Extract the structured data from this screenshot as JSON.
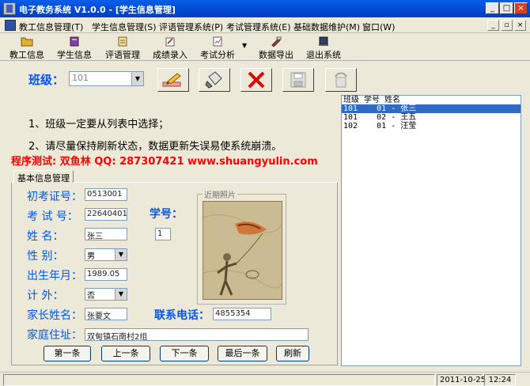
{
  "window": {
    "title": "电子教务系统 V1.0.0 - [学生信息管理]",
    "buttons": {
      "minimize": "_",
      "maximize": "□",
      "close": "×"
    }
  },
  "menubar": {
    "items": [
      {
        "label": "教工信息管理(T)"
      },
      {
        "label": "学生信息管理(S)"
      },
      {
        "label": "评语管理系统(P)"
      },
      {
        "label": "考试管理系统(E)"
      },
      {
        "label": "基础数据维护(M)"
      },
      {
        "label": "窗口(W)"
      }
    ],
    "mdi": {
      "minimize": "_",
      "restore": "▫",
      "close": "×"
    }
  },
  "toolbar": {
    "items": [
      {
        "label": "教工信息",
        "icon": "folder-icon",
        "color": "#e0b030"
      },
      {
        "label": "学生信息",
        "icon": "book-icon",
        "color": "#8040a0"
      },
      {
        "label": "评语管理",
        "icon": "notepad-icon",
        "color": "#e0c060"
      },
      {
        "label": "成绩录入",
        "icon": "grade-entry-icon",
        "color": "#c04040"
      },
      {
        "label": "考试分析",
        "icon": "exam-analysis-icon",
        "color": "#c04080"
      },
      {
        "label": "数据导出",
        "icon": "export-icon",
        "color": "#a04040"
      },
      {
        "label": "退出系统",
        "icon": "exit-icon",
        "color": "#304060"
      }
    ],
    "dropdown_glyph": "▼"
  },
  "class_select": {
    "label": "班级：",
    "value": "101",
    "arrow": "▼"
  },
  "action_buttons": [
    {
      "icon": "edit-pencil-icon"
    },
    {
      "icon": "paint-bucket-icon"
    },
    {
      "icon": "delete-x-icon"
    },
    {
      "icon": "save-disk-icon"
    },
    {
      "icon": "undo-icon"
    }
  ],
  "notes": {
    "note1": "1、班级一定要从列表中选择；",
    "note2": "2、请尽量保持刷新状态，数据更新失误易使系统崩溃。",
    "tester": "程序测试: 双鱼林  QQ: 287307421  www.shuangyulin.com"
  },
  "tab": {
    "label": "基本信息管理"
  },
  "form": {
    "exam_id_label": "初考证号：",
    "exam_id": "0513001",
    "test_no_label": "考 试 号：",
    "test_no": "22640401",
    "student_no_label": "学号：",
    "student_no": "1",
    "name_label": "姓    名：",
    "name": "张三",
    "gender_label": "性    别：",
    "gender": "男",
    "birth_label": "出生年月：",
    "birth": "1989.05",
    "outside_label": "计    外：",
    "outside": "否",
    "parent_label": "家长姓名：",
    "parent": "张要文",
    "phone_label": "联系电话：",
    "phone": "4855354",
    "address_label": "家庭住址：",
    "address": "双甸镇石南村2组",
    "photo_legend": "近期照片",
    "arrow": "▼"
  },
  "nav_buttons": {
    "first": "第一条",
    "prev": "上一条",
    "next": "下一条",
    "last": "最后一条",
    "refresh": "刷新"
  },
  "student_list": {
    "header": "班级 学号 姓名",
    "rows": [
      {
        "text": "101    01 - 张三",
        "selected": true
      },
      {
        "text": "101    02 - 王五",
        "selected": false
      },
      {
        "text": "102    01 - 汪莹",
        "selected": false
      }
    ]
  },
  "statusbar": {
    "date": "2011-10-25",
    "time": "12:24"
  },
  "colors": {
    "accent_blue": "#0055ff",
    "tester_red": "#ff0000",
    "selection": "#316ac5"
  }
}
